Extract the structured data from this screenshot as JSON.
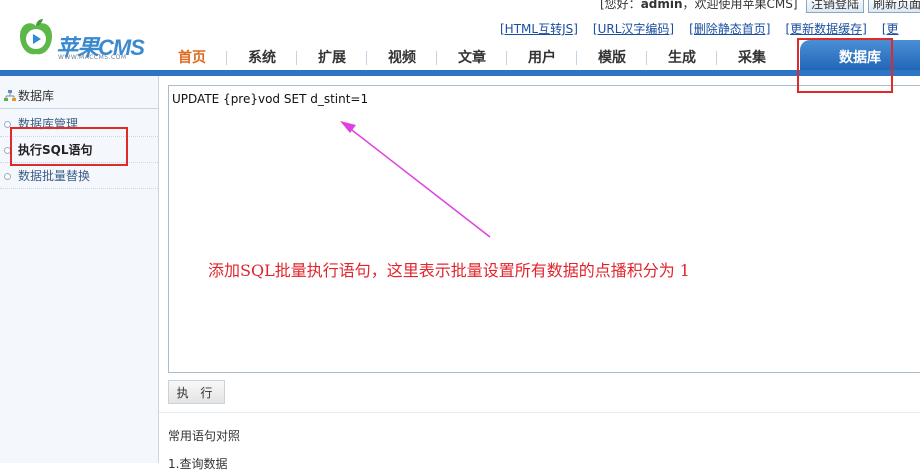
{
  "app": {
    "logo_text": "苹果CMS",
    "logo_url_text": "WWW.MACCMS.COM"
  },
  "userbar": {
    "greeting": "[您好：",
    "username": "admin",
    "welcome": "，欢迎使用苹果CMS]",
    "logout_label": "注销登陆",
    "refresh_label": "刷新页面"
  },
  "quicklinks": [
    "[HTML互转JS]",
    "[URL汉字编码]",
    "[删除静态首页]",
    "[更新数据缓存]",
    "[更"
  ],
  "nav": [
    "首页",
    "系统",
    "扩展",
    "视频",
    "文章",
    "用户",
    "模版",
    "生成",
    "采集"
  ],
  "nav_active": "数据库",
  "sidebar": {
    "title": "数据库",
    "items": [
      {
        "label": "数据库管理",
        "active": false
      },
      {
        "label": "执行SQL语句",
        "active": true
      },
      {
        "label": "数据批量替换",
        "active": false
      }
    ]
  },
  "sql": {
    "value": "UPDATE {pre}vod SET d_stint=1"
  },
  "annotation": "添加SQL批量执行语句，这里表示批量设置所有数据的点播积分为 1",
  "execute_label": "执 行",
  "section": {
    "title": "常用语句对照",
    "item1": "1.查询数据"
  },
  "colors": {
    "accent": "#2e74c4",
    "highlight_box": "#e02a2a",
    "arrow": "#e040e0"
  }
}
